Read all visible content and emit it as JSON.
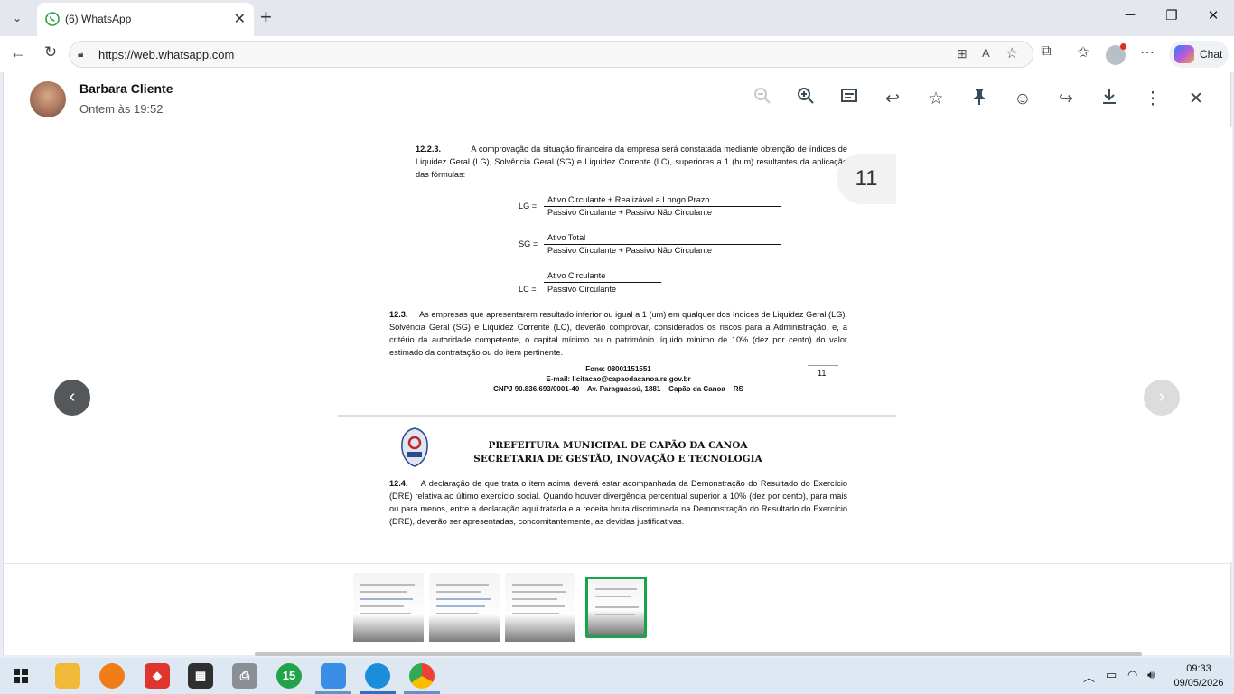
{
  "browser": {
    "tab_title": "(6) WhatsApp",
    "url": "https://web.whatsapp.com",
    "chat_label": "Chat"
  },
  "header": {
    "sender": "Barbara Cliente",
    "time": "Ontem às 19:52"
  },
  "document": {
    "p1_num": "12.2.3.",
    "p1": "A comprovação da situação financeira da empresa será constatada mediante obtenção de índices de Liquidez Geral (LG), Solvência Geral (SG) e Liquidez Corrente (LC), superiores a 1 (hum) resultantes da aplicação das fórmulas:",
    "lg_label": "LG =",
    "lg_num": "Ativo Circulante + Realizável a Longo Prazo",
    "lg_den": "Passivo Circulante + Passivo Não Circulante",
    "sg_label": "SG =",
    "sg_num": "Ativo Total",
    "sg_den": "Passivo Circulante + Passivo Não Circulante",
    "lc_label": "LC =",
    "lc_num": "Ativo Circulante",
    "lc_den": "Passivo Circulante",
    "p2_num": "12.3.",
    "p2": "As empresas que apresentarem resultado inferior ou igual a 1 (um) em qualquer dos índices de Liquidez Geral (LG), Solvência Geral (SG) e Liquidez Corrente (LC), deverão comprovar, considerados os riscos para a Administração, e, a critério da autoridade competente, o capital mínimo ou o patrimônio líquido mínimo de 10% (dez por cento) do valor estimado da contratação ou do item pertinente.",
    "footer_phone": "Fone: 08001151551",
    "footer_email": "E-mail: licitacao@capaodacanoa.rs.gov.br",
    "footer_cnpj": "CNPJ 90.836.693/0001-40 – Av. Paraguassú, 1881 – Capão da Canoa – RS",
    "page_number": "11",
    "heading1": "PREFEITURA MUNICIPAL DE CAPÃO DA CANOA",
    "heading2": "SECRETARIA DE GESTÃO, INOVAÇÃO E TECNOLOGIA",
    "p3_num": "12.4.",
    "p3": "A declaração de que trata o item acima deverá estar acompanhada da Demonstração do Resultado do Exercício (DRE) relativa ao último exercício social. Quando houver divergência percentual superior a 10% (dez por cento), para mais ou para menos, entre a declaração aqui tratada e a receita bruta discriminada na Demonstração do Resultado do Exercício (DRE), deverão ser apresentadas, concomitantemente, as devidas justificativas."
  },
  "viewer": {
    "page_badge": "11"
  },
  "taskbar": {
    "badge_count": "15",
    "clock_time": "09:33",
    "clock_date": "09/05/2026"
  }
}
